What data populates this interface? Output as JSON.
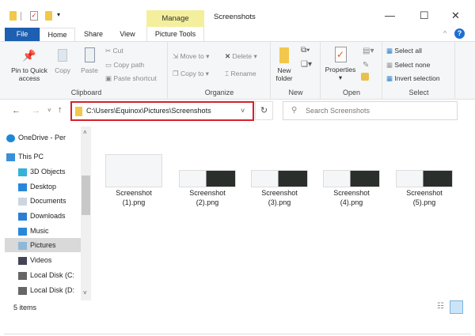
{
  "window": {
    "title": "Screenshots",
    "context_tab": "Manage",
    "context_group": "Picture Tools",
    "controls": {
      "minimize": "—",
      "maximize": "☐",
      "close": "✕"
    }
  },
  "tabs": [
    {
      "label": "File"
    },
    {
      "label": "Home",
      "active": true
    },
    {
      "label": "Share"
    },
    {
      "label": "View"
    }
  ],
  "ribbon": {
    "clipboard": {
      "label": "Clipboard",
      "pin": "Pin to Quick access",
      "pin_l1": "Pin to Quick",
      "pin_l2": "access",
      "copy": "Copy",
      "paste": "Paste",
      "cut": "Cut",
      "copy_path": "Copy path",
      "paste_shortcut": "Paste shortcut"
    },
    "organize": {
      "label": "Organize",
      "move_to": "Move to",
      "copy_to": "Copy to",
      "delete": "Delete",
      "rename": "Rename"
    },
    "new": {
      "label": "New",
      "new_folder_l1": "New",
      "new_folder_l2": "folder"
    },
    "open": {
      "label": "Open",
      "properties": "Properties"
    },
    "select": {
      "label": "Select",
      "select_all": "Select all",
      "select_none": "Select none",
      "invert": "Invert selection"
    }
  },
  "address": {
    "path": "C:\\Users\\Equinox\\Pictures\\Screenshots",
    "search_placeholder": "Search Screenshots"
  },
  "nav": [
    {
      "label": "OneDrive - Per",
      "icon": "cloud-icon",
      "indent": 0
    },
    {
      "label": "This PC",
      "icon": "computer-icon",
      "indent": 0
    },
    {
      "label": "3D Objects",
      "icon": "cube-icon",
      "indent": 1
    },
    {
      "label": "Desktop",
      "icon": "desktop-icon",
      "indent": 1
    },
    {
      "label": "Documents",
      "icon": "document-icon",
      "indent": 1
    },
    {
      "label": "Downloads",
      "icon": "download-icon",
      "indent": 1
    },
    {
      "label": "Music",
      "icon": "music-icon",
      "indent": 1
    },
    {
      "label": "Pictures",
      "icon": "picture-icon",
      "indent": 1,
      "selected": true
    },
    {
      "label": "Videos",
      "icon": "video-icon",
      "indent": 1
    },
    {
      "label": "Local Disk (C:",
      "icon": "drive-icon",
      "indent": 1
    },
    {
      "label": "Local Disk (D:",
      "icon": "drive-icon",
      "indent": 1
    }
  ],
  "files": [
    {
      "l1": "Screenshot",
      "l2": "(1).png"
    },
    {
      "l1": "Screenshot",
      "l2": "(2).png"
    },
    {
      "l1": "Screenshot",
      "l2": "(3).png"
    },
    {
      "l1": "Screenshot",
      "l2": "(4).png"
    },
    {
      "l1": "Screenshot",
      "l2": "(5).png"
    }
  ],
  "status": {
    "count": "5 items"
  },
  "colors": {
    "accent": "#1d5fb0",
    "highlight": "#d6202c",
    "manage": "#f4ef9c"
  }
}
